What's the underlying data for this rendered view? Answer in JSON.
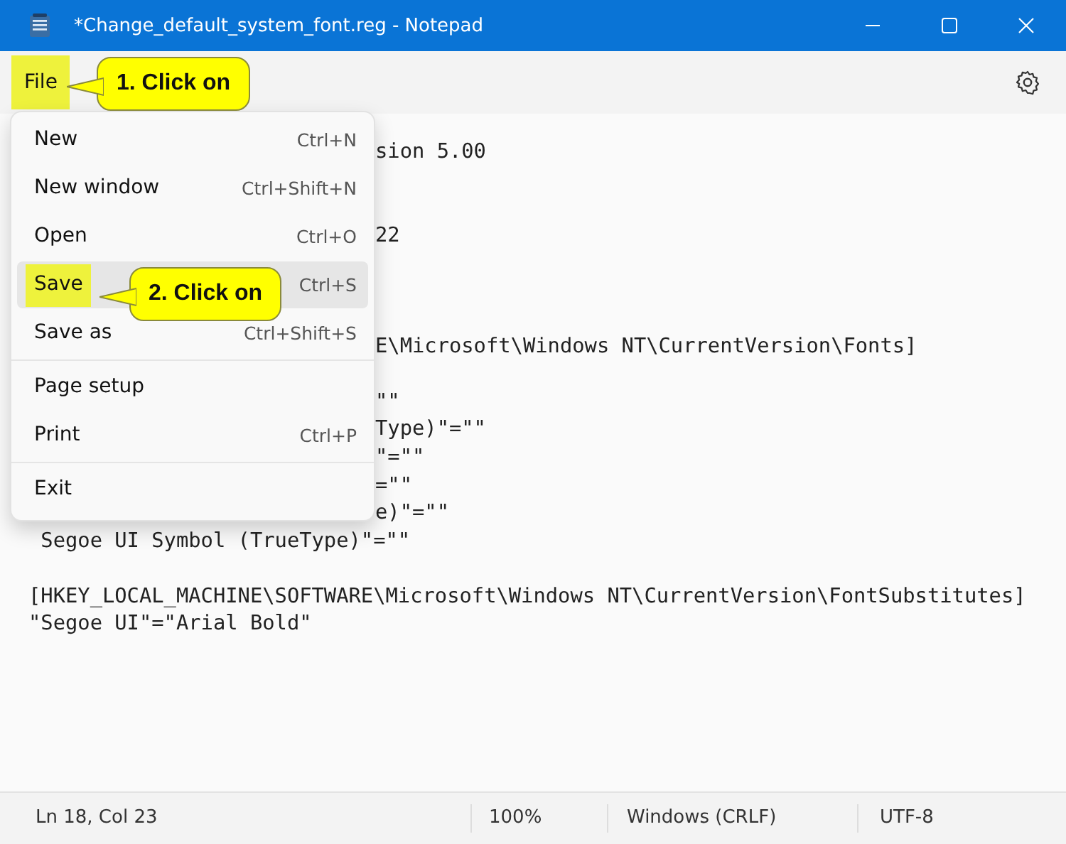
{
  "window": {
    "title": "*Change_default_system_font.reg - Notepad"
  },
  "menu_bar": {
    "items": [
      {
        "label": "File",
        "highlighted": true
      }
    ]
  },
  "editor": {
    "lines": [
      {
        "kind": "cut",
        "text": "sion 5.00"
      },
      {
        "kind": "blank"
      },
      {
        "kind": "blank"
      },
      {
        "kind": "cut",
        "text": "22"
      },
      {
        "kind": "blank"
      },
      {
        "kind": "blank"
      },
      {
        "kind": "blank"
      },
      {
        "kind": "cut",
        "text": "E\\Microsoft\\Windows NT\\CurrentVersion\\Fonts]"
      },
      {
        "kind": "blank"
      },
      {
        "kind": "cut",
        "text": "\"\""
      },
      {
        "kind": "cut",
        "text": "Type)\"=\"\""
      },
      {
        "kind": "cut",
        "text": "\"=\"\""
      },
      {
        "kind": "cut",
        "text": "=\"\""
      },
      {
        "kind": "cut",
        "text": "e)\"=\"\""
      },
      {
        "kind": "full",
        "text": " Segoe UI Symbol (TrueType)\"=\"\""
      },
      {
        "kind": "blank"
      },
      {
        "kind": "full",
        "text": "[HKEY_LOCAL_MACHINE\\SOFTWARE\\Microsoft\\Windows NT\\CurrentVersion\\FontSubstitutes]"
      },
      {
        "kind": "full",
        "text": "\"Segoe UI\"=\"Arial Bold\""
      }
    ]
  },
  "file_menu": {
    "items": [
      {
        "kind": "item",
        "label": "New",
        "shortcut": "Ctrl+N",
        "selected": false,
        "highlighted": false
      },
      {
        "kind": "item",
        "label": "New window",
        "shortcut": "Ctrl+Shift+N",
        "selected": false,
        "highlighted": false
      },
      {
        "kind": "item",
        "label": "Open",
        "shortcut": "Ctrl+O",
        "selected": false,
        "highlighted": false
      },
      {
        "kind": "item",
        "label": "Save",
        "shortcut": "Ctrl+S",
        "selected": true,
        "highlighted": true
      },
      {
        "kind": "item",
        "label": "Save as",
        "shortcut": "Ctrl+Shift+S",
        "selected": false,
        "highlighted": false
      },
      {
        "kind": "separator"
      },
      {
        "kind": "item",
        "label": "Page setup",
        "selected": false,
        "highlighted": false
      },
      {
        "kind": "item",
        "label": "Print",
        "shortcut": "Ctrl+P",
        "selected": false,
        "highlighted": false
      },
      {
        "kind": "separator"
      },
      {
        "kind": "item",
        "label": "Exit",
        "selected": false,
        "highlighted": false
      }
    ]
  },
  "callouts": [
    {
      "text": "1. Click on"
    },
    {
      "text": "2. Click on"
    }
  ],
  "status_bar": {
    "position": "Ln 18, Col 23",
    "zoom": "100%",
    "line_ending": "Windows (CRLF)",
    "encoding": "UTF-8"
  }
}
